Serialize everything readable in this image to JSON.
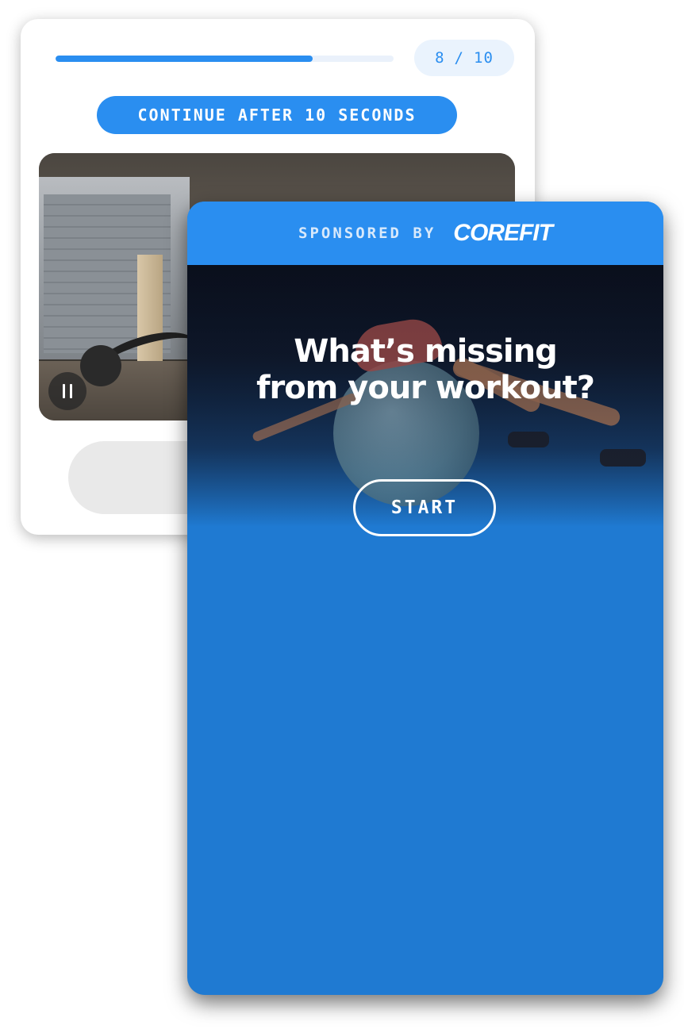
{
  "quiz": {
    "progress_fraction": 0.76,
    "step_current": "8",
    "step_separator": "/",
    "step_total": "10",
    "continue_label": "CONTINUE AFTER 10 SECONDS",
    "video_control_icon": "pause-icon"
  },
  "sponsor": {
    "label": "SPONSORED BY",
    "brand": "COREFIT"
  },
  "promo": {
    "headline_line1": "What’s missing",
    "headline_line2": "from your workout?",
    "start_label": "START"
  },
  "colors": {
    "accent_blue": "#2a8ef0",
    "card_blue": "#1f7ad2",
    "progress_track": "#eaf1fb"
  }
}
